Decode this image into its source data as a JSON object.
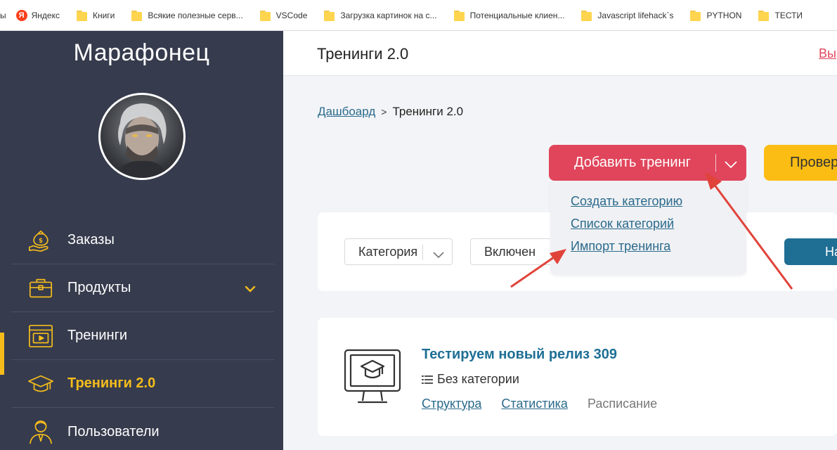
{
  "bookmarks": {
    "lead": "ы",
    "items": [
      {
        "label": "Яндекс",
        "icon": "yandex-icon"
      },
      {
        "label": "Книги",
        "icon": "folder-icon"
      },
      {
        "label": "Всякие полезные серв...",
        "icon": "folder-icon"
      },
      {
        "label": "VSCode",
        "icon": "folder-icon"
      },
      {
        "label": "Загрузка картинок на с...",
        "icon": "folder-icon"
      },
      {
        "label": "Потенциальные клиен...",
        "icon": "folder-icon"
      },
      {
        "label": "Javascript lifehack`s",
        "icon": "folder-icon"
      },
      {
        "label": "PYTHON",
        "icon": "folder-icon"
      },
      {
        "label": "ТЕСТИ",
        "icon": "folder-icon"
      }
    ]
  },
  "sidebar": {
    "brand": "Марафонец",
    "items": [
      {
        "label": "Заказы",
        "icon": "money-bag-hand-icon"
      },
      {
        "label": "Продукты",
        "icon": "briefcase-icon"
      },
      {
        "label": "Тренинги",
        "icon": "video-screen-icon"
      },
      {
        "label": "Тренинги 2.0",
        "icon": "graduation-cap-icon"
      },
      {
        "label": "Пользователи",
        "icon": "user-icon"
      }
    ],
    "active": "Тренинги 2.0"
  },
  "header": {
    "title": "Тренинги 2.0",
    "logout": "Вы"
  },
  "breadcrumb": {
    "home": "Дашбоард",
    "current": "Тренинги 2.0"
  },
  "actions": {
    "add_training": "Добавить тренинг",
    "check": "Провер",
    "dropdown": [
      "Создать категорию",
      "Список категорий",
      "Импорт тренинга"
    ]
  },
  "filters": {
    "category": "Категория",
    "enabled": "Включен",
    "apply": "На"
  },
  "training": {
    "title": "Тестируем новый релиз 309",
    "category": "Без категории",
    "links": [
      "Структура",
      "Статистика"
    ],
    "schedule": "Расписание"
  },
  "colors": {
    "sidebar_bg": "#363b4d",
    "active": "#f5bc1c",
    "primary_red": "#e0455b",
    "primary_yellow": "#fbbd14",
    "link": "#2a6a8c",
    "annotation_arrow": "#e0433a"
  }
}
